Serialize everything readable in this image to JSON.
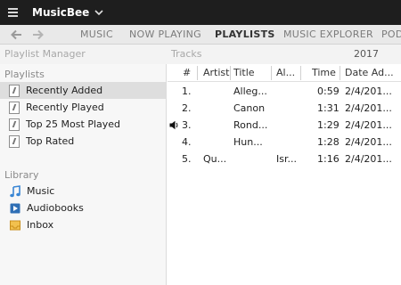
{
  "app": {
    "title": "MusicBee"
  },
  "nav": {
    "tabs": [
      {
        "label": "MUSIC"
      },
      {
        "label": "NOW PLAYING"
      },
      {
        "label": "PLAYLISTS"
      },
      {
        "label": "MUSIC EXPLORER"
      },
      {
        "label": "POD"
      }
    ],
    "active_tab": "PLAYLISTS"
  },
  "left_panel": {
    "header": "Playlist Manager",
    "playlists_title": "Playlists",
    "playlists": [
      {
        "label": "Recently Added",
        "selected": true
      },
      {
        "label": "Recently Played",
        "selected": false
      },
      {
        "label": "Top 25 Most Played",
        "selected": false
      },
      {
        "label": "Top Rated",
        "selected": false
      }
    ],
    "library_title": "Library",
    "library": [
      {
        "label": "Music",
        "icon": "music-note-icon"
      },
      {
        "label": "Audiobooks",
        "icon": "audiobook-icon"
      },
      {
        "label": "Inbox",
        "icon": "inbox-icon"
      }
    ]
  },
  "tracks_panel": {
    "header": "Tracks",
    "year": "2017",
    "columns": [
      "#",
      "Artist",
      "Title",
      "Al...",
      "Time",
      "Date Ad..."
    ],
    "rows": [
      {
        "num": "1.",
        "artist": "",
        "title": "Alleg...",
        "album": "",
        "time": "0:59",
        "date": "2/4/201...",
        "playing": false
      },
      {
        "num": "2.",
        "artist": "",
        "title": "Canon",
        "album": "",
        "time": "1:31",
        "date": "2/4/201...",
        "playing": false
      },
      {
        "num": "3.",
        "artist": "",
        "title": "Rond...",
        "album": "",
        "time": "1:29",
        "date": "2/4/201...",
        "playing": true
      },
      {
        "num": "4.",
        "artist": "",
        "title": "Hun...",
        "album": "",
        "time": "1:28",
        "date": "2/4/201...",
        "playing": false
      },
      {
        "num": "5.",
        "artist": "Qu...",
        "title": "",
        "album": "Isr...",
        "time": "1:16",
        "date": "2/4/201...",
        "playing": false
      }
    ]
  }
}
